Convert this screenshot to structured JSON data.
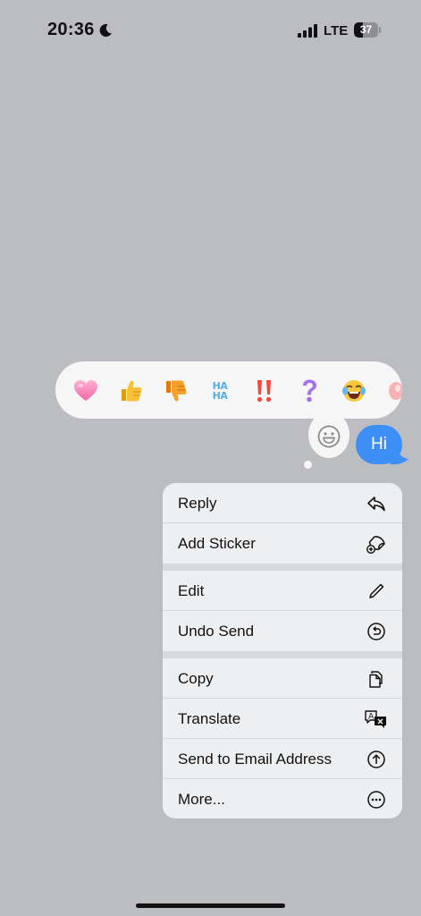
{
  "status_bar": {
    "time": "20:36",
    "network": "LTE",
    "battery_level": "37",
    "battery_fraction": 0.37,
    "icons": [
      "moon-icon",
      "signal-icon",
      "battery-icon"
    ]
  },
  "tapback": {
    "reactions": [
      {
        "name": "heart-icon",
        "glyph": "heart"
      },
      {
        "name": "thumbs-up-icon",
        "glyph": "thumbs-up"
      },
      {
        "name": "thumbs-down-icon",
        "glyph": "thumbs-down"
      },
      {
        "name": "haha-icon",
        "text_top": "HA",
        "text_bottom": "HA"
      },
      {
        "name": "exclamation-icon",
        "glyph": "double-exclamation"
      },
      {
        "name": "question-icon",
        "glyph": "question"
      },
      {
        "name": "laughing-emoji-icon",
        "glyph": "tears-of-joy"
      },
      {
        "name": "partial-emoji-icon",
        "glyph": "partial"
      }
    ],
    "emoji_picker_icon": "smiley-icon"
  },
  "message": {
    "text": "Hi",
    "bubble_color": "#3e8ff5"
  },
  "context_menu": {
    "groups": [
      [
        {
          "label": "Reply",
          "icon": "reply-icon"
        },
        {
          "label": "Add Sticker",
          "icon": "sticker-icon"
        }
      ],
      [
        {
          "label": "Edit",
          "icon": "pencil-icon"
        },
        {
          "label": "Undo Send",
          "icon": "undo-icon"
        }
      ],
      [
        {
          "label": "Copy",
          "icon": "copy-icon"
        },
        {
          "label": "Translate",
          "icon": "translate-icon"
        },
        {
          "label": "Send to Email Address",
          "icon": "send-up-icon"
        },
        {
          "label": "More...",
          "icon": "more-icon"
        }
      ]
    ]
  },
  "colors": {
    "background": "#bcbdc1",
    "menu_background": "#eeeff1",
    "accent": "#3e8ff5"
  }
}
